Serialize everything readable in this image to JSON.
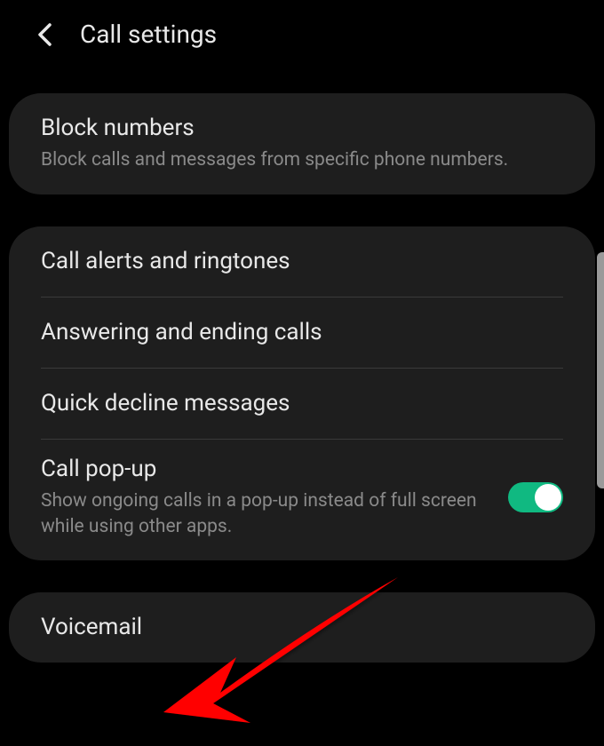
{
  "header": {
    "title": "Call settings"
  },
  "sections": {
    "block": {
      "title": "Block numbers",
      "subtitle": "Block calls and messages from specific phone numbers."
    },
    "alerts": {
      "title": "Call alerts and ringtones"
    },
    "answering": {
      "title": "Answering and ending calls"
    },
    "quickdecline": {
      "title": "Quick decline messages"
    },
    "popup": {
      "title": "Call pop-up",
      "subtitle": "Show ongoing calls in a pop-up instead of full screen while using other apps.",
      "toggle_on": true
    },
    "voicemail": {
      "title": "Voicemail"
    }
  },
  "annotation": {
    "arrow_color": "#ff0000"
  }
}
